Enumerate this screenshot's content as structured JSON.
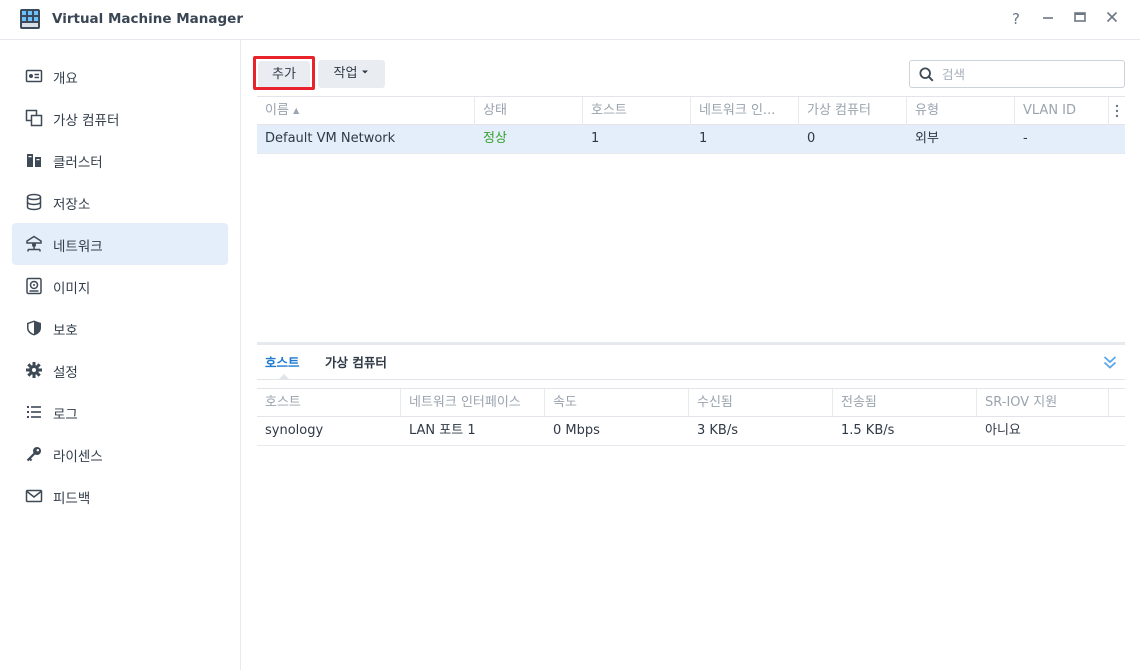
{
  "app": {
    "title": "Virtual Machine Manager",
    "icon": "vmm-app-icon",
    "window_controls": {
      "help": "?",
      "minimize": "—",
      "maximize": "□",
      "close": "✕"
    }
  },
  "sidebar": {
    "items": [
      {
        "label": "개요",
        "icon": "overview-icon"
      },
      {
        "label": "가상 컴퓨터",
        "icon": "virtual-machine-icon"
      },
      {
        "label": "클러스터",
        "icon": "cluster-icon"
      },
      {
        "label": "저장소",
        "icon": "storage-icon"
      },
      {
        "label": "네트워크",
        "icon": "network-icon",
        "active": true
      },
      {
        "label": "이미지",
        "icon": "image-icon"
      },
      {
        "label": "보호",
        "icon": "protection-icon"
      },
      {
        "label": "설정",
        "icon": "settings-icon"
      },
      {
        "label": "로그",
        "icon": "log-icon"
      },
      {
        "label": "라이센스",
        "icon": "license-icon"
      },
      {
        "label": "피드백",
        "icon": "feedback-icon"
      }
    ]
  },
  "toolbar": {
    "add_label": "추가",
    "action_label": "작업",
    "search_placeholder": "검색"
  },
  "network_table": {
    "columns": [
      "이름",
      "상태",
      "호스트",
      "네트워크 인...",
      "가상 컴퓨터",
      "유형",
      "VLAN ID"
    ],
    "sort_indicator": "▲",
    "rows": [
      {
        "name": "Default VM Network",
        "status": "정상",
        "host": "1",
        "interfaces": "1",
        "vms": "0",
        "type": "외부",
        "vlan": "-"
      }
    ]
  },
  "detail": {
    "tabs": [
      "호스트",
      "가상 컴퓨터"
    ],
    "active_tab": "호스트",
    "columns": [
      "호스트",
      "네트워크 인터페이스",
      "속도",
      "수신됨",
      "전송됨",
      "SR-IOV 지원"
    ],
    "rows": [
      {
        "host": "synology",
        "interface": "LAN 포트 1",
        "speed": "0 Mbps",
        "received": "3 KB/s",
        "sent": "1.5 KB/s",
        "sriov": "아니요"
      }
    ]
  },
  "colors": {
    "accent": "#1f7ad1",
    "selection": "#e3eefa",
    "status_ok": "#36a12e",
    "highlight_border": "#e8232b"
  }
}
